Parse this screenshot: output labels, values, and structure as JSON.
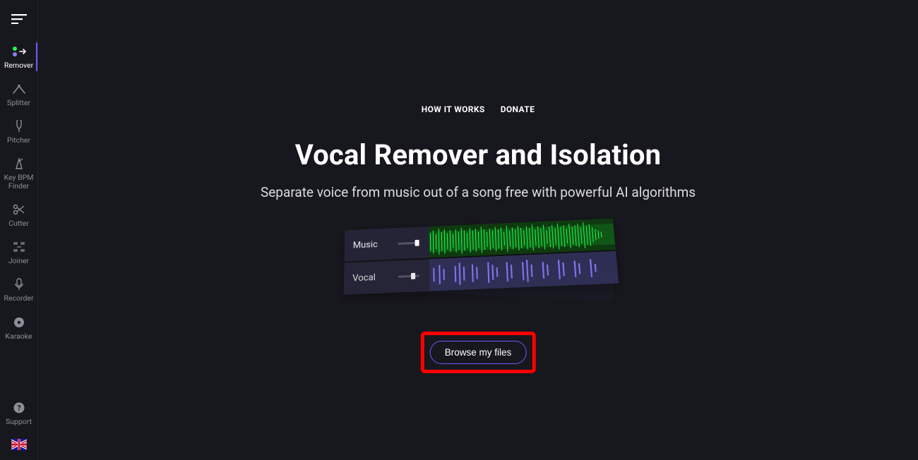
{
  "sidebar": {
    "items": [
      {
        "label": "Remover"
      },
      {
        "label": "Splitter"
      },
      {
        "label": "Pitcher"
      },
      {
        "label": "Key BPM\nFinder"
      },
      {
        "label": "Cutter"
      },
      {
        "label": "Joiner"
      },
      {
        "label": "Recorder"
      },
      {
        "label": "Karaoke"
      }
    ],
    "support_label": "Support"
  },
  "topnav": {
    "how_it_works": "HOW IT WORKS",
    "donate": "DONATE"
  },
  "hero": {
    "title": "Vocal Remover and Isolation",
    "subtitle": "Separate voice from music out of a song free with powerful AI algorithms"
  },
  "illustration": {
    "music_label": "Music",
    "vocal_label": "Vocal"
  },
  "cta": {
    "browse_label": "Browse my files"
  },
  "colors": {
    "accent": "#6b5bff",
    "music_wave": "#1dff4a",
    "vocal_wave": "#8b7bff",
    "highlight_box": "#ff0000"
  }
}
